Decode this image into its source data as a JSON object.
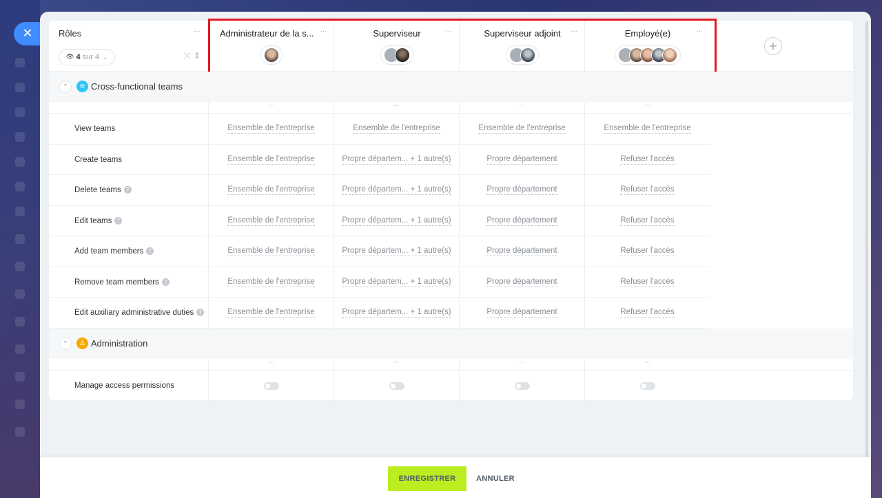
{
  "roles_header": {
    "title": "Rôles",
    "filter_count": "4",
    "filter_suffix": "sur 4"
  },
  "columns": [
    {
      "name": "Administrateur de la s...",
      "avatars": [
        "p1"
      ]
    },
    {
      "name": "Superviseur",
      "avatars": [
        "gray",
        "p2"
      ]
    },
    {
      "name": "Superviseur adjoint",
      "avatars": [
        "gray",
        "p3"
      ]
    },
    {
      "name": "Employé(e)",
      "avatars": [
        "gray",
        "p1",
        "p4",
        "p3",
        "p5"
      ]
    }
  ],
  "sections": [
    {
      "title": "Cross-functional teams",
      "icon": "team-icon",
      "icon_color": "#2fc6f6",
      "rows": [
        {
          "label": "View teams",
          "help": false,
          "values": [
            "Ensemble de l'entreprise",
            "Ensemble de l'entreprise",
            "Ensemble de l'entreprise",
            "Ensemble de l'entreprise"
          ]
        },
        {
          "label": "Create teams",
          "help": false,
          "values": [
            "Ensemble de l'entreprise",
            "Propre départem... + 1 autre(s)",
            "Propre département",
            "Refuser l'accès"
          ]
        },
        {
          "label": "Delete teams",
          "help": true,
          "values": [
            "Ensemble de l'entreprise",
            "Propre départem... + 1 autre(s)",
            "Propre département",
            "Refuser l'accès"
          ]
        },
        {
          "label": "Edit teams",
          "help": true,
          "values": [
            "Ensemble de l'entreprise",
            "Propre départem... + 1 autre(s)",
            "Propre département",
            "Refuser l'accès"
          ]
        },
        {
          "label": "Add team members",
          "help": true,
          "values": [
            "Ensemble de l'entreprise",
            "Propre départem... + 1 autre(s)",
            "Propre département",
            "Refuser l'accès"
          ]
        },
        {
          "label": "Remove team members",
          "help": true,
          "values": [
            "Ensemble de l'entreprise",
            "Propre départem... + 1 autre(s)",
            "Propre département",
            "Refuser l'accès"
          ]
        },
        {
          "label": "Edit auxiliary administrative duties",
          "help": true,
          "values": [
            "Ensemble de l'entreprise",
            "Propre départem... + 1 autre(s)",
            "Propre département",
            "Refuser l'accès"
          ]
        }
      ]
    },
    {
      "title": "Administration",
      "icon": "admin-icon",
      "icon_color": "#f7a700",
      "rows": [
        {
          "label": "Manage access permissions",
          "help": false,
          "toggles": [
            false,
            false,
            false,
            false
          ]
        }
      ]
    }
  ],
  "footer": {
    "save_label": "ENREGISTRER",
    "cancel_label": "ANNULER"
  },
  "colors": {
    "accent_save": "#bbed21",
    "highlight": "#e0191f",
    "close_button": "#3f8cff"
  }
}
